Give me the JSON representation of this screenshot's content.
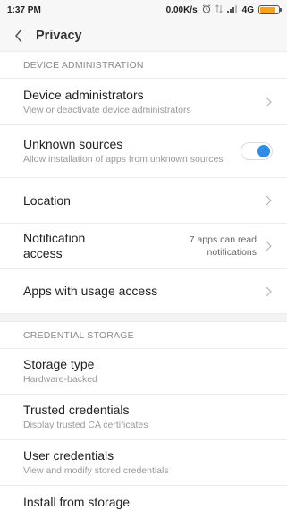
{
  "status_bar": {
    "time": "1:37 PM",
    "speed": "0.00K/s",
    "network": "4G",
    "battery_level": 0.9
  },
  "header": {
    "title": "Privacy"
  },
  "sections": {
    "device_admin": {
      "header": "DEVICE ADMINISTRATION",
      "device_administrators": {
        "title": "Device administrators",
        "subtitle": "View or deactivate device administrators"
      },
      "unknown_sources": {
        "title": "Unknown sources",
        "subtitle": "Allow installation of apps from unknown sources",
        "enabled": true
      },
      "location": {
        "title": "Location"
      },
      "notification_access": {
        "title": "Notification access",
        "value": "7 apps can read notifications"
      },
      "usage_access": {
        "title": "Apps with usage access"
      }
    },
    "credential_storage": {
      "header": "CREDENTIAL STORAGE",
      "storage_type": {
        "title": "Storage type",
        "subtitle": "Hardware-backed"
      },
      "trusted_credentials": {
        "title": "Trusted credentials",
        "subtitle": "Display trusted CA certificates"
      },
      "user_credentials": {
        "title": "User credentials",
        "subtitle": "View and modify stored credentials"
      },
      "install_from_storage": {
        "title": "Install from storage"
      }
    }
  },
  "colors": {
    "accent": "#2f8de4",
    "battery": "#f2a51a"
  },
  "icons": {
    "back": "chevron-left-icon",
    "chevron": "chevron-right-icon"
  }
}
